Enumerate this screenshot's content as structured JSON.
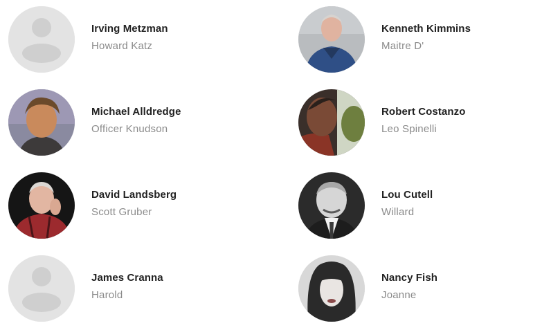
{
  "cast": [
    {
      "actor": "Irving Metzman",
      "character": "Howard Katz",
      "photo": "placeholder-person-icon"
    },
    {
      "actor": "Kenneth Kimmins",
      "character": "Maitre D'",
      "photo": "actor-photo"
    },
    {
      "actor": "Michael Alldredge",
      "character": "Officer Knudson",
      "photo": "actor-photo"
    },
    {
      "actor": "Robert Costanzo",
      "character": "Leo Spinelli",
      "photo": "actor-photo"
    },
    {
      "actor": "David Landsberg",
      "character": "Scott Gruber",
      "photo": "actor-photo"
    },
    {
      "actor": "Lou Cutell",
      "character": "Willard",
      "photo": "actor-photo"
    },
    {
      "actor": "James Cranna",
      "character": "Harold",
      "photo": "placeholder-person-icon"
    },
    {
      "actor": "Nancy Fish",
      "character": "Joanne",
      "photo": "actor-photo"
    }
  ]
}
